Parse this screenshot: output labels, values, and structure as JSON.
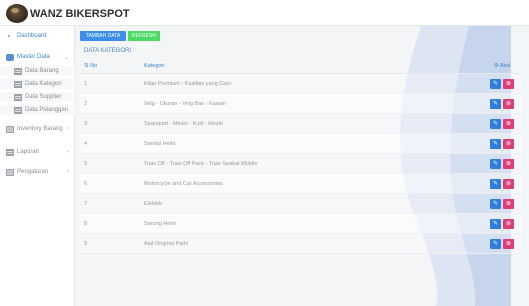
{
  "app": {
    "brand": "WANZ BIKERSPOT"
  },
  "sidebar": {
    "items": [
      {
        "label": "Dashboard",
        "icon": "dashboard-icon"
      },
      {
        "label": "Master Data",
        "icon": "database-icon"
      },
      {
        "label": "Data Barang",
        "icon": "table-icon"
      },
      {
        "label": "Data Kategori",
        "icon": "table-icon"
      },
      {
        "label": "Data Supplier",
        "icon": "table-icon"
      },
      {
        "label": "Data Pelanggan",
        "icon": "table-icon"
      },
      {
        "label": "Inventory Barang",
        "icon": "document-icon"
      },
      {
        "label": "Laporan",
        "icon": "table-icon"
      },
      {
        "label": "Pengaturan",
        "icon": "document-icon"
      }
    ]
  },
  "toolbar": {
    "add_label": "TAMBAH DATA",
    "refresh_label": "REFRESH"
  },
  "main": {
    "section_title": "DATA KATEGORI",
    "columns": {
      "no": "No",
      "kategori": "Kategori",
      "aksi": "Aksi"
    },
    "rows": [
      {
        "no": "1",
        "kategori": "Kilap Premium - Kualitas yang Carn"
      },
      {
        "no": "2",
        "kategori": "Velg - Ukuran - Velg Ban - Kawan"
      },
      {
        "no": "3",
        "kategori": "Sparepart - Mesin - Kulit - Mesin"
      },
      {
        "no": "4",
        "kategori": "Sandal Helm"
      },
      {
        "no": "5",
        "kategori": "Tuas Off - Tuas Off Pack - Tuas Spakat Mobile"
      },
      {
        "no": "6",
        "kategori": "Motorcycle and Car Accessories"
      },
      {
        "no": "7",
        "kategori": "Elektrik"
      },
      {
        "no": "8",
        "kategori": "Sarung Helm"
      },
      {
        "no": "9",
        "kategori": "Alat Original Parts"
      }
    ]
  },
  "colors": {
    "primary": "#3d8ee8",
    "success": "#4cd964",
    "danger": "#e23c78",
    "link": "#3d85c6"
  }
}
